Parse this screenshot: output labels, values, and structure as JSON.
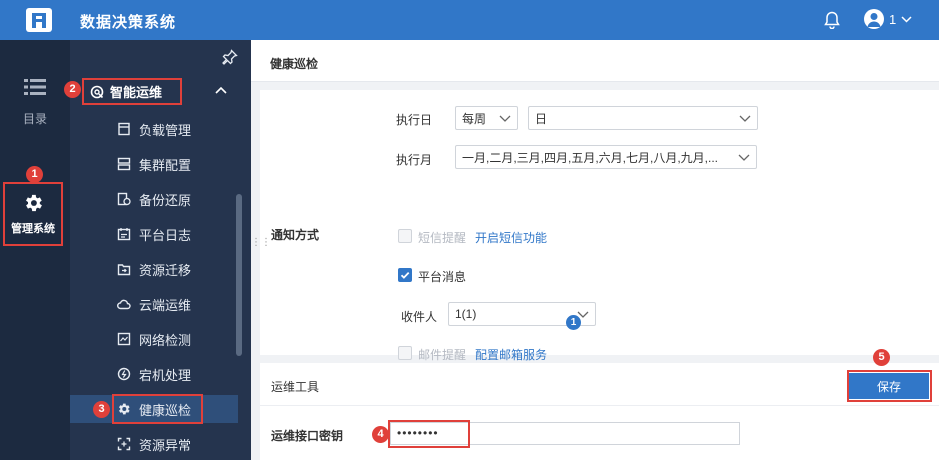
{
  "app": {
    "title": "数据决策系统",
    "user_name": "1"
  },
  "rail": {
    "catalog_label": "目录",
    "manage_label": "管理系统"
  },
  "submenu": {
    "group_label": "智能运维",
    "items": [
      {
        "label": "负载管理",
        "icon": "load-icon"
      },
      {
        "label": "集群配置",
        "icon": "cluster-icon"
      },
      {
        "label": "备份还原",
        "icon": "backup-icon"
      },
      {
        "label": "平台日志",
        "icon": "log-icon"
      },
      {
        "label": "资源迁移",
        "icon": "migrate-icon"
      },
      {
        "label": "云端运维",
        "icon": "cloud-icon"
      },
      {
        "label": "网络检测",
        "icon": "network-icon"
      },
      {
        "label": "宕机处理",
        "icon": "crash-icon"
      },
      {
        "label": "健康巡检",
        "icon": "health-icon",
        "active": true
      },
      {
        "label": "资源异常",
        "icon": "resource-icon"
      }
    ]
  },
  "badges": [
    "1",
    "2",
    "3",
    "4",
    "5"
  ],
  "page": {
    "tab_title": "健康巡检",
    "notify": {
      "exec_day_label": "执行日",
      "exec_day_period": "每周",
      "exec_day_value": "日",
      "exec_month_label": "执行月",
      "exec_month_value": "一月,二月,三月,四月,五月,六月,七月,八月,九月,...",
      "notify_method_label": "通知方式",
      "sms_label": "短信提醒",
      "sms_link": "开启短信功能",
      "platform_label": "平台消息",
      "recipient_label": "收件人",
      "recipient_value": "1(1)",
      "recipient_count": "1",
      "mail_label": "邮件提醒",
      "mail_link": "配置邮箱服务"
    },
    "ops": {
      "section_title": "运维工具",
      "save_label": "保存",
      "key_label": "运维接口密钥",
      "key_value": "••••••••"
    }
  },
  "colors": {
    "brand": "#3177c8",
    "highlight": "#e0403a",
    "rail": "#1c2a40",
    "submenu": "#25344e"
  }
}
